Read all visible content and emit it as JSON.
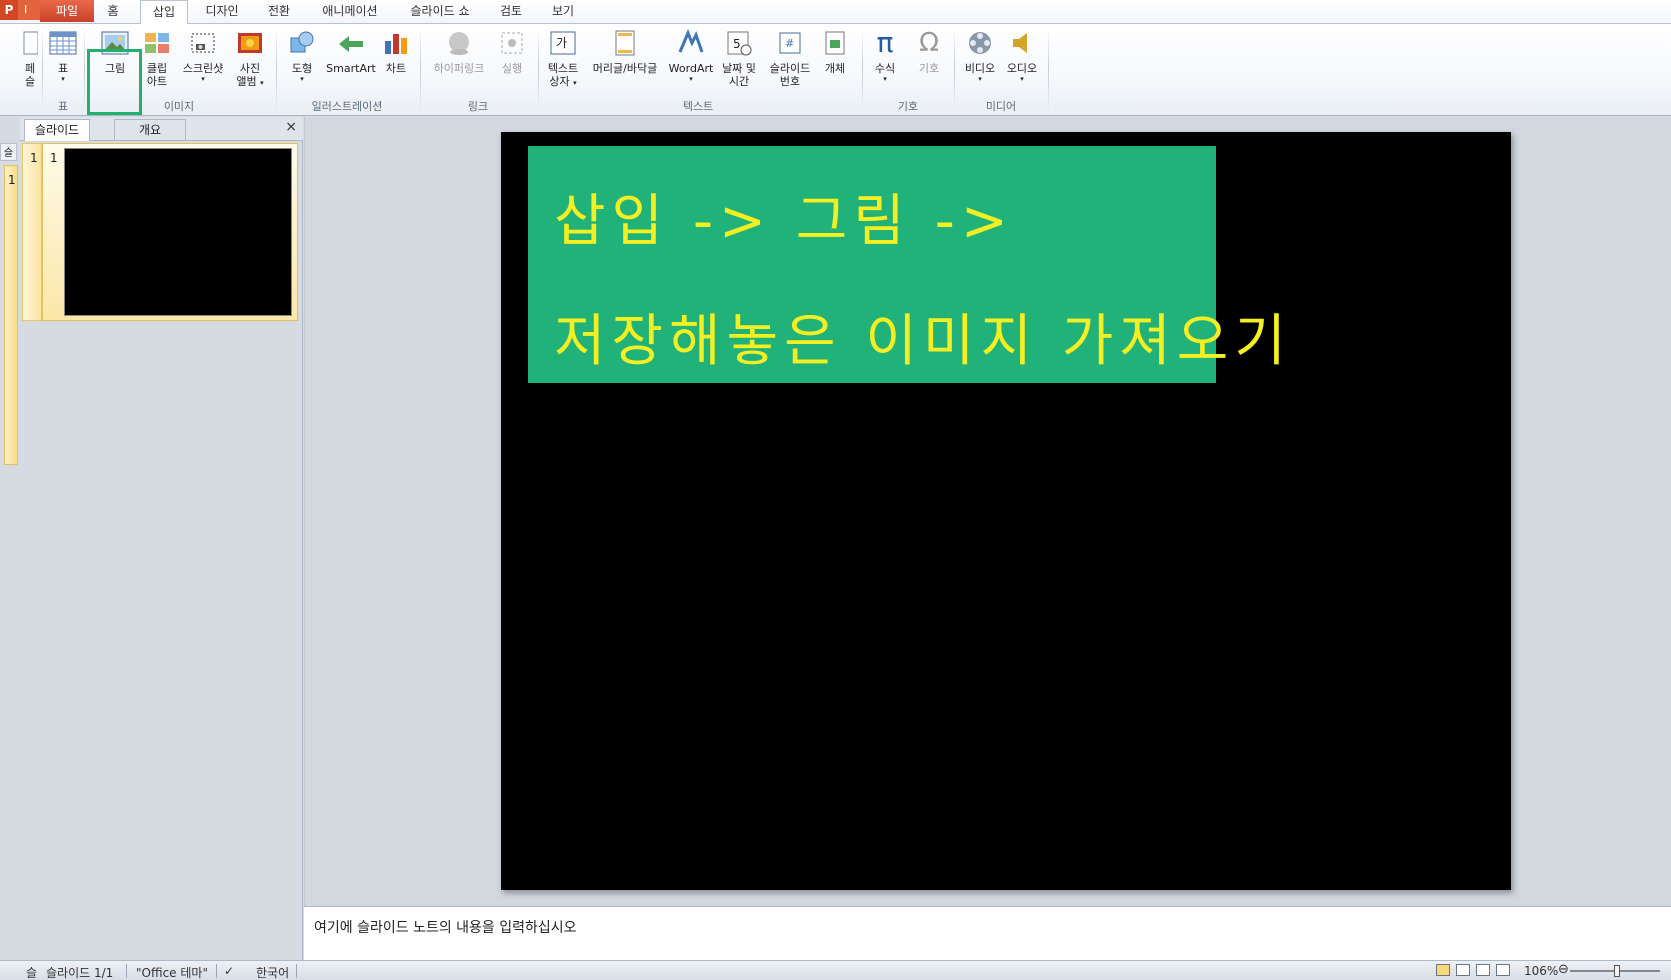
{
  "app": {
    "icon_letter": "P",
    "qat_letter": "I"
  },
  "tabs": {
    "file": "파일",
    "home": "홈",
    "insert": "삽입",
    "design": "디자인",
    "transitions": "전환",
    "animations": "애니메이션",
    "slideshow": "슬라이드 쇼",
    "review": "검토",
    "view": "보기",
    "active": "삽입"
  },
  "ribbon": {
    "partial_left": [
      "페",
      "슬"
    ],
    "table": "표",
    "picture": "그림",
    "clipart": [
      "클립",
      "아트"
    ],
    "screenshot": "스크린샷",
    "album": [
      "사진",
      "앨범"
    ],
    "shapes": "도형",
    "smartart": "SmartArt",
    "chart": "차트",
    "hyperlink": "하이퍼링크",
    "action": "실행",
    "textbox": [
      "텍스트",
      "상자"
    ],
    "headerfooter": "머리글/바닥글",
    "wordart": "WordArt",
    "datetime": [
      "날짜 및",
      "시간"
    ],
    "slidenum": [
      "슬라이드",
      "번호"
    ],
    "object": "개체",
    "equation": "수식",
    "symbol": "기호",
    "video": "비디오",
    "audio": "오디오",
    "groups": {
      "tables": "표",
      "images": "이미지",
      "illustrations": "일러스트레이션",
      "links": "링크",
      "text": "텍스트",
      "symbols": "기호",
      "media": "미디어"
    }
  },
  "slides_pane": {
    "tab_slides": "슬라이드",
    "tab_outline": "개요",
    "close": "×",
    "slide_number": "1",
    "strip_tab": "슬",
    "strip_number": "1"
  },
  "slide": {
    "line1": "삽입 -> 그림 ->",
    "line2": "저장해놓은 이미지 가져오기",
    "box_color": "#21b27a",
    "text_color": "#f3ef22"
  },
  "notes": {
    "placeholder": "여기에 슬라이드 노트의 내용을 입력하십시오"
  },
  "status": {
    "icon_label": "슬",
    "slide_info": "슬라이드 1/1",
    "theme": "\"Office 테마\"",
    "language": "한국어",
    "zoom": "106%"
  },
  "colors": {
    "accent_highlight": "#23b06e",
    "file_tab": "#d24726"
  }
}
